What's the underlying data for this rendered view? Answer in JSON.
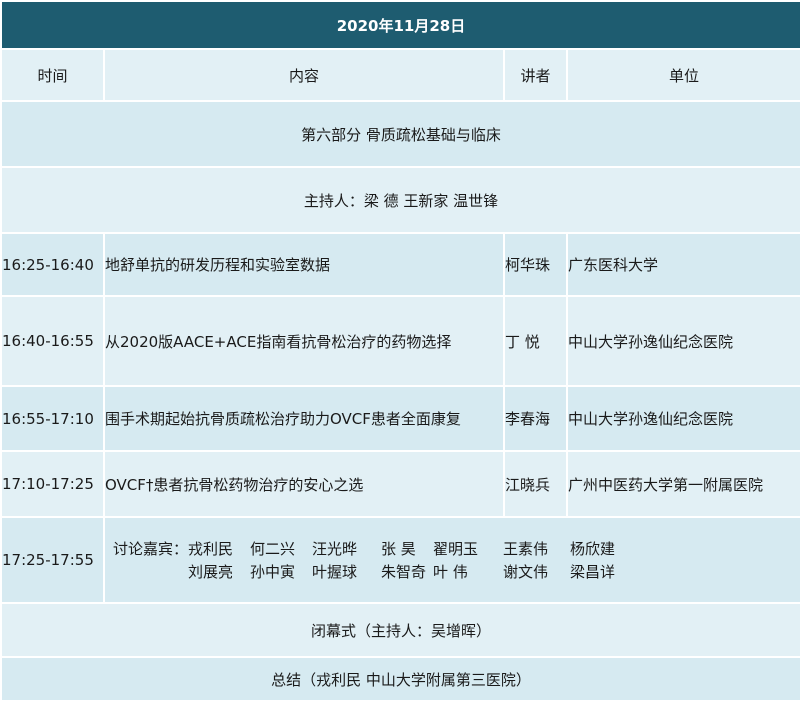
{
  "date": "2020年11月28日",
  "headers": {
    "time": "时间",
    "content": "内容",
    "speaker": "讲者",
    "unit": "单位"
  },
  "section_title": "第六部分 骨质疏松基础与临床",
  "hosts": "主持人：梁 德 王新家 温世锋",
  "talks": [
    {
      "time": "16:25-16:40",
      "topic": "地舒单抗的研发历程和实验室数据",
      "speaker": "柯华珠",
      "unit": "广东医科大学"
    },
    {
      "time": "16:40-16:55",
      "topic": "从2020版AACE+ACE指南看抗骨松治疗的药物选择",
      "speaker": "丁 悦",
      "unit": "中山大学孙逸仙纪念医院"
    },
    {
      "time": "16:55-17:10",
      "topic": "围手术期起始抗骨质疏松治疗助力OVCF患者全面康复",
      "speaker": "李春海",
      "unit": "中山大学孙逸仙纪念医院"
    },
    {
      "time": "17:10-17:25",
      "topic": "OVCF†患者抗骨松药物治疗的安心之选",
      "speaker": "江晓兵",
      "unit": "广州中医药大学第一附属医院"
    }
  ],
  "discussion": {
    "time": "17:25-17:55",
    "label": "讨论嘉宾：",
    "names": [
      "戎利民",
      "何二兴",
      "汪光晔",
      "张 昊",
      "翟明玉",
      "王素伟",
      "杨欣建",
      "刘展亮",
      "孙中寅",
      "叶握球",
      "朱智奇",
      "叶 伟",
      "谢文伟",
      "梁昌详"
    ]
  },
  "closing": "闭幕式（主持人：吴增晖）",
  "summary": "总结（戎利民 中山大学附属第三医院）"
}
